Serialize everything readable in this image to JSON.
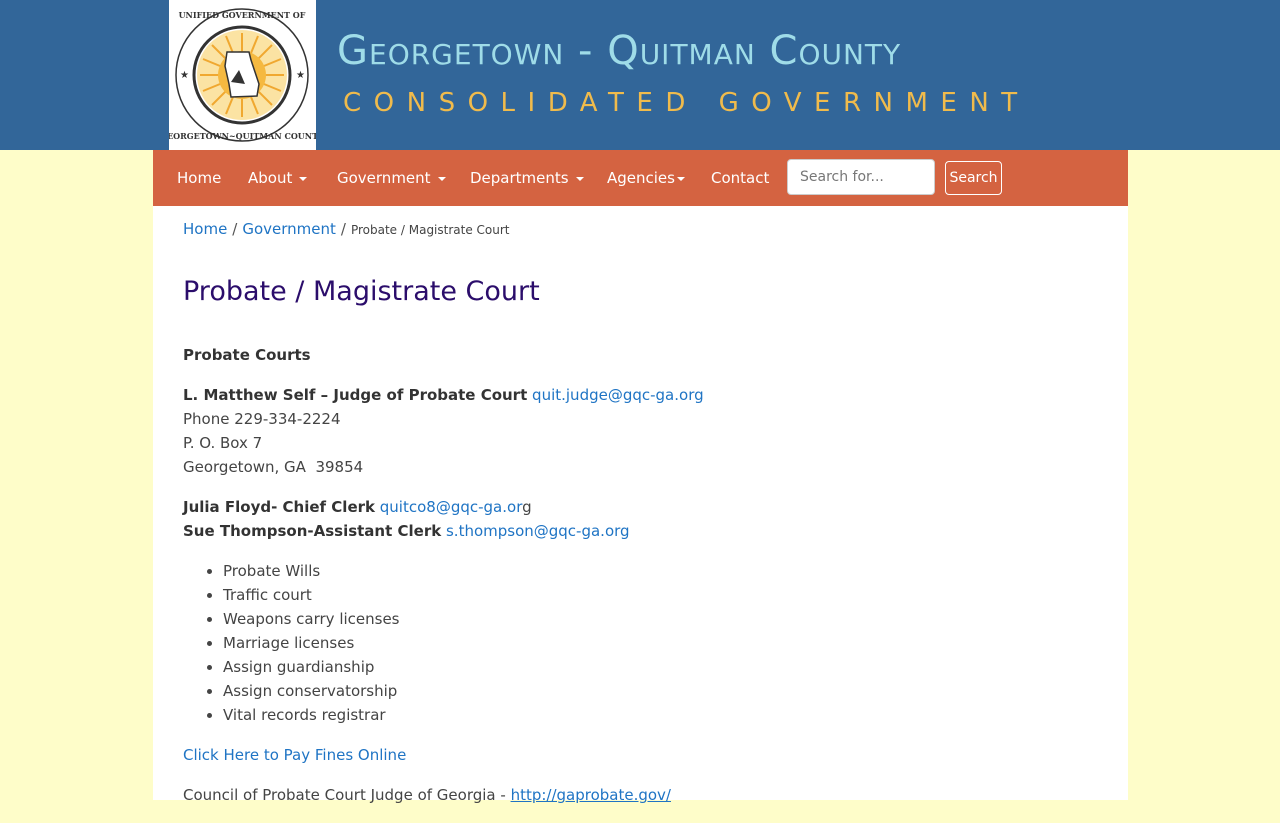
{
  "header": {
    "seal_alt": "Unified Government of Georgetown-Quitman County",
    "title": "Georgetown - Quitman County",
    "subtitle": "CONSOLIDATED GOVERNMENT"
  },
  "nav": {
    "items": [
      {
        "label": "Home"
      },
      {
        "label": "About"
      },
      {
        "label": "Government"
      },
      {
        "label": "Departments"
      },
      {
        "label": "Agencies"
      },
      {
        "label": "Contact"
      }
    ],
    "search_placeholder": "Search for...",
    "search_button": "Search"
  },
  "breadcrumb": {
    "home": "Home",
    "parent": "Government",
    "current": "Probate / Magistrate Court"
  },
  "page": {
    "title": "Probate / Magistrate Court",
    "section_heading": "Probate Courts",
    "judge": {
      "name": "L. Matthew Self – Judge of Probate Court",
      "email": "quit.judge@gqc-ga.org",
      "phone": "Phone 229-334-2224",
      "address1": "P. O. Box 7",
      "address2": "Georgetown, GA  39854"
    },
    "clerks": [
      {
        "name": "Julia Floyd- Chief Clerk",
        "email_link": "quitco8@gqc-ga.or",
        "email_tail": "g"
      },
      {
        "name": "Sue Thompson-Assistant Clerk",
        "email_link": "s.thompson@gqc-ga.org",
        "email_tail": ""
      }
    ],
    "services": [
      "Probate Wills",
      "Traffic court",
      "Weapons carry licenses",
      "Marriage licenses",
      "Assign guardianship",
      "Assign conservatorship",
      "Vital records registrar"
    ],
    "pay_fines_link": "Click Here to Pay Fines Online",
    "council_text": "Council of Probate Court Judge of Georgia - ",
    "council_link": "http://gaprobate.gov/"
  }
}
